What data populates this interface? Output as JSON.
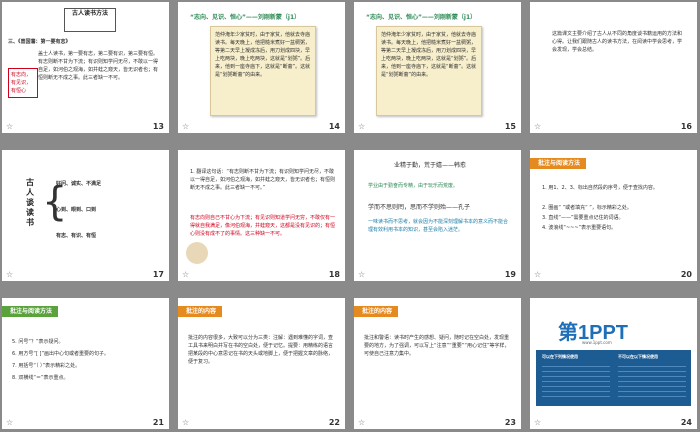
{
  "slides": {
    "s13": {
      "number": "13",
      "title": "古人读书方法",
      "section": "三、《曾国藩：第一要有志》",
      "tag_lines": [
        "有志向，",
        "有见识，",
        "有恒心"
      ],
      "body": "盖士人读书，第一要有志，第二要有识，第三要有恒。有志则断不甘为下流；有识则知学问无尽，不敢以一得自足，如河伯之观海，如井蛙之窥天，皆无识者也；有恒则断无不成之事。此三者缺一不可。"
    },
    "s14": {
      "number": "14",
      "title": "“志向、见识、恒心”——刘刚新蒙（j1）",
      "body": "范仲淹年少家贫时，由于家贫，他就去寺庙读书。每天晚上，他把糙米煮好一盆稠粥，等第二天早上凝成冻后，用刀划成四块，早上吃两块，晚上吃两块，这就是“划粥”。后来，他到一座寺庙下，这就是“断齑”。这就是“划粥断齑”的由来。"
    },
    "s15": {
      "number": "15",
      "title": "“志向、见识、恒心”——刘刚新蒙（j1）",
      "body": "范仲淹年少家贫时，由于家贫，他就去寺庙读书。每天晚上，他把糙米煮好一盆稠粥，等第二天早上凝成冻后，用刀划成四块，早上吃两块，晚上吃两块，这就是“划粥”。后来，他到一座寺庙下，这就是“断齑”。这就是“划粥断齑”的由来。"
    },
    "s16": {
      "number": "16",
      "body": "这篇课文主要介绍了古人从不同的角度谈书籍运用的方法和心得。让我们跟随古人的读书方法，在阅读中学会思考，学会发现，学会总结。"
    },
    "s17": {
      "number": "17",
      "title": "古人谈读书",
      "lines": [
        "好问、诚实、不满足",
        "心到、眼到、口到",
        "有志、有识、有恒"
      ]
    },
    "s18": {
      "number": "18",
      "body": "1. 翻译这句话：“有志则断不甘为下流；有识则知学问无尽，不敢以一得自足，如河伯之观海，如井蛙之窥天，皆无识者也；有恒则断无不成之事。此三者缺一不可。”",
      "answer": "有志向则自己不甘心为下流；有见识则知道学问无穷，不敢仅有一得就自我满足，像河伯观海，井蛙窥天，这都是没有见识的；有恒心则没有成不了的事情。这三种缺一不可。"
    },
    "s19": {
      "number": "19",
      "title": "业精于勤，荒于嬉——韩愈",
      "line1": "学业由于勤奋而专精，由于玩乐而荒废。",
      "title2": "学而不思则罔，思而不学则殆——孔子",
      "line2": "一味读书而不思考，就会因为不能深刻理解书本的意义而不能合理有效利用书本的知识，甚至会陷入迷茫。"
    },
    "s20": {
      "number": "20",
      "header": "批注与阅读方法",
      "items": [
        "1. 用1、2、3、标出自然段的序号，便于查找内容。",
        "2. 圈画“  ”或者填充“ ”，标示精彩之处。",
        "3. 直线“——”需要重点记住的词语。",
        "4. 波浪线“~~~”表示重要语句。"
      ]
    },
    "s21": {
      "number": "21",
      "header": "批注与阅读方法",
      "items": [
        "5. 问号“？”表示疑问。",
        "6. 用方号“[ ]”画出中心句或者重要的句子。",
        "7. 用括号“（ ）”表示精彩之处。",
        "8. 双横线“＝”表示重点。"
      ]
    },
    "s22": {
      "number": "22",
      "header": "批注的内容",
      "body": "批注的内容很多，大致可以分为三类：注解：遇到难懂的字词，查工具书来明白并写在书的空白处，便于记忆。提要：用精练的语言把某段的中心意思记在书的天头或地脚上，便于把握文章的脉络，便于复习。"
    },
    "s23": {
      "number": "23",
      "header": "批注的内容",
      "body": "批注和警语：读书时产生的感想、疑问，随时记在空白处，发现重要的地方，为了强调，可以写上“注意”“重要”“用心记住”等字样，可使自己注意力集中。"
    },
    "s24": {
      "number": "24",
      "logo": "第1PPT",
      "logo_sub": "www.1ppt.com",
      "col1_title": "可以在下列情况使用",
      "col2_title": "不可以在以下情况使用"
    }
  }
}
